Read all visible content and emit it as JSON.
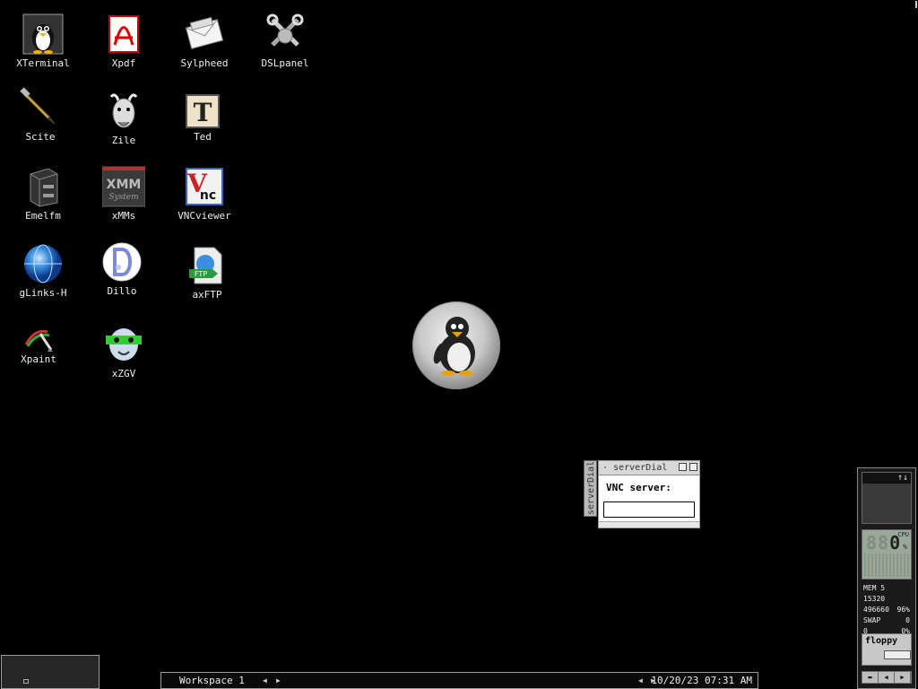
{
  "desktop": {
    "icons": [
      {
        "label": "XTerminal",
        "name": "xterminal-icon"
      },
      {
        "label": "Xpdf",
        "name": "xpdf-icon"
      },
      {
        "label": "Sylpheed",
        "name": "sylpheed-icon"
      },
      {
        "label": "DSLpanel",
        "name": "dslpanel-icon"
      },
      {
        "label": "Scite",
        "name": "scite-icon"
      },
      {
        "label": "Zile",
        "name": "zile-icon"
      },
      {
        "label": "Ted",
        "name": "ted-icon"
      },
      {
        "label": "Emelfm",
        "name": "emelfm-icon"
      },
      {
        "label": "xMMs",
        "name": "xmms-icon"
      },
      {
        "label": "VNCviewer",
        "name": "vncviewer-icon"
      },
      {
        "label": "gLinks-H",
        "name": "glinks-icon"
      },
      {
        "label": "Dillo",
        "name": "dillo-icon"
      },
      {
        "label": "axFTP",
        "name": "axftp-icon"
      },
      {
        "label": "Xpaint",
        "name": "xpaint-icon"
      },
      {
        "label": "xZGV",
        "name": "xzgv-icon"
      }
    ]
  },
  "server_dialog": {
    "title": "serverDial",
    "side_tab": "serverDial",
    "prompt": "VNC server:",
    "input_value": ""
  },
  "taskbar": {
    "workspace": "Workspace 1",
    "clock": "10/20/23 07:31 AM"
  },
  "dock": {
    "cpu_reading": "88",
    "cpu_value": "0",
    "cpu_label": "CPU",
    "cpu_unit": "%",
    "mem_label": "MEM",
    "mem_used": "5 15320",
    "mem_free": "496660",
    "mem_pct": "96%",
    "swap_label": "SWAP",
    "swap_used": "0",
    "swap_free": "0",
    "swap_pct": "0%",
    "floppy_label": "floppy"
  }
}
